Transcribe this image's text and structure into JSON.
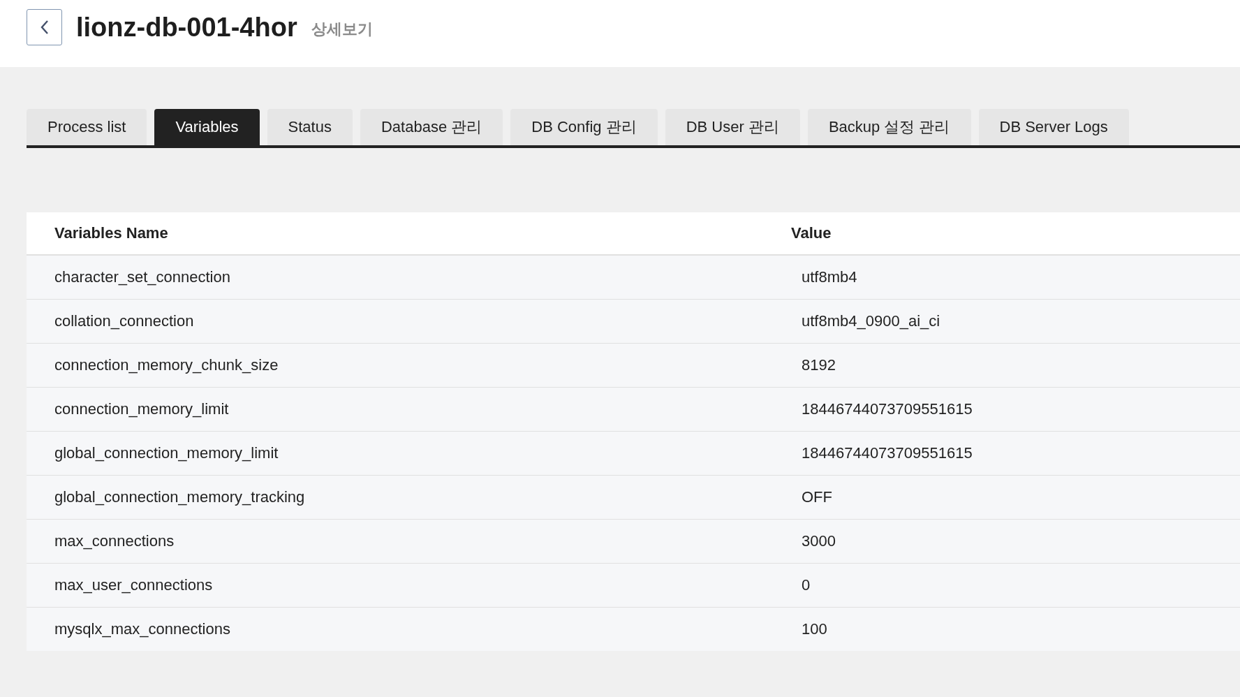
{
  "header": {
    "title": "lionz-db-001-4hor",
    "subtitle": "상세보기"
  },
  "tabs": [
    {
      "label": "Process list",
      "selected": false
    },
    {
      "label": "Variables",
      "selected": true
    },
    {
      "label": "Status",
      "selected": false
    },
    {
      "label": "Database 관리",
      "selected": false
    },
    {
      "label": "DB Config 관리",
      "selected": false
    },
    {
      "label": "DB User 관리",
      "selected": false
    },
    {
      "label": "Backup 설정 관리",
      "selected": false
    },
    {
      "label": "DB Server Logs",
      "selected": false
    }
  ],
  "table": {
    "columns": [
      "Variables Name",
      "Value"
    ],
    "rows": [
      [
        "character_set_connection",
        "utf8mb4"
      ],
      [
        "collation_connection",
        "utf8mb4_0900_ai_ci"
      ],
      [
        "connection_memory_chunk_size",
        "8192"
      ],
      [
        "connection_memory_limit",
        "18446744073709551615"
      ],
      [
        "global_connection_memory_limit",
        "18446744073709551615"
      ],
      [
        "global_connection_memory_tracking",
        "OFF"
      ],
      [
        "max_connections",
        "3000"
      ],
      [
        "max_user_connections",
        "0"
      ],
      [
        "mysqlx_max_connections",
        "100"
      ]
    ]
  }
}
